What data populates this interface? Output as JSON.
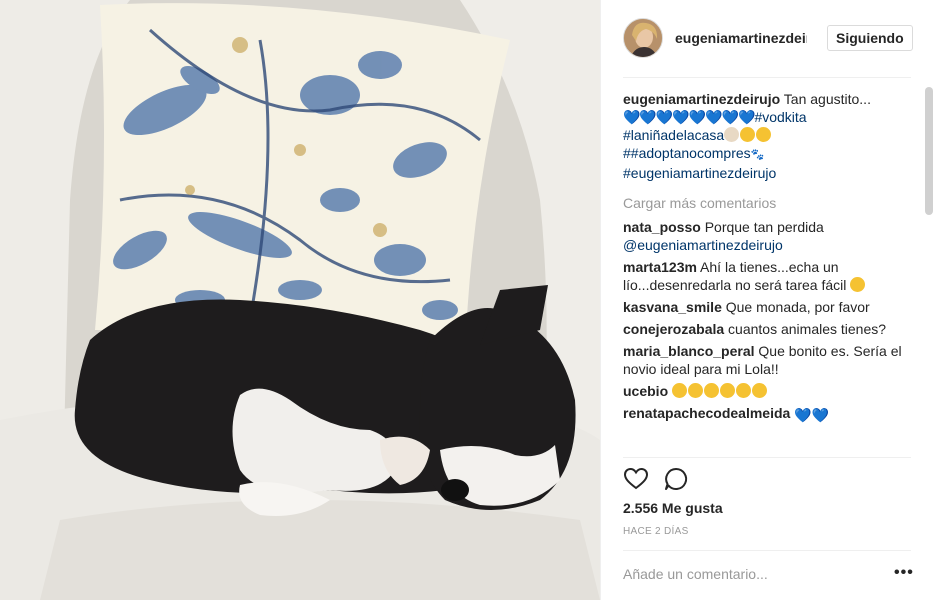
{
  "post": {
    "username": "eugeniamartinezdeirujo",
    "follow_label": "Siguiendo",
    "caption": {
      "username": "eugeniamartinezdeirujo",
      "text": " Tan agustito...",
      "hearts": "💙💙💙💙💙💙💙💙",
      "tag1": "#vodkita",
      "tag2": "#laniñadelacasa",
      "tag3": "##adoptanocompres",
      "tag4": "#eugeniamartinezdeirujo"
    },
    "load_more": "Cargar más comentarios",
    "comments": [
      {
        "user": "nata_posso",
        "text": " Porque tan perdida",
        "mention": "@eugeniamartinezdeirujo"
      },
      {
        "user": "marta123m",
        "text": " Ahí la tienes...echa un lío...desenredarla no será tarea fácil"
      },
      {
        "user": "kasvana_smile",
        "text": " Que monada, por favor"
      },
      {
        "user": "conejerozabala",
        "text": " cuantos animales tienes?"
      },
      {
        "user": "maria_blanco_peral",
        "text": " Que bonito es. Sería el novio ideal para mi Lola!!"
      },
      {
        "user": "ucebio",
        "text": " "
      },
      {
        "user": "renatapachecodealmeida",
        "text": " "
      }
    ],
    "likes": "2.556 Me gusta",
    "time": "HACE 2 DÍAS",
    "comment_placeholder": "Añade un comentario...",
    "more_label": "•••"
  },
  "icons": {
    "like": "heart-outline-icon",
    "comment": "speech-bubble-icon",
    "more": "more-options-icon"
  },
  "colors": {
    "link": "#003569",
    "accent_blue": "#3897f0",
    "muted": "#999999",
    "divider": "#efefef"
  }
}
